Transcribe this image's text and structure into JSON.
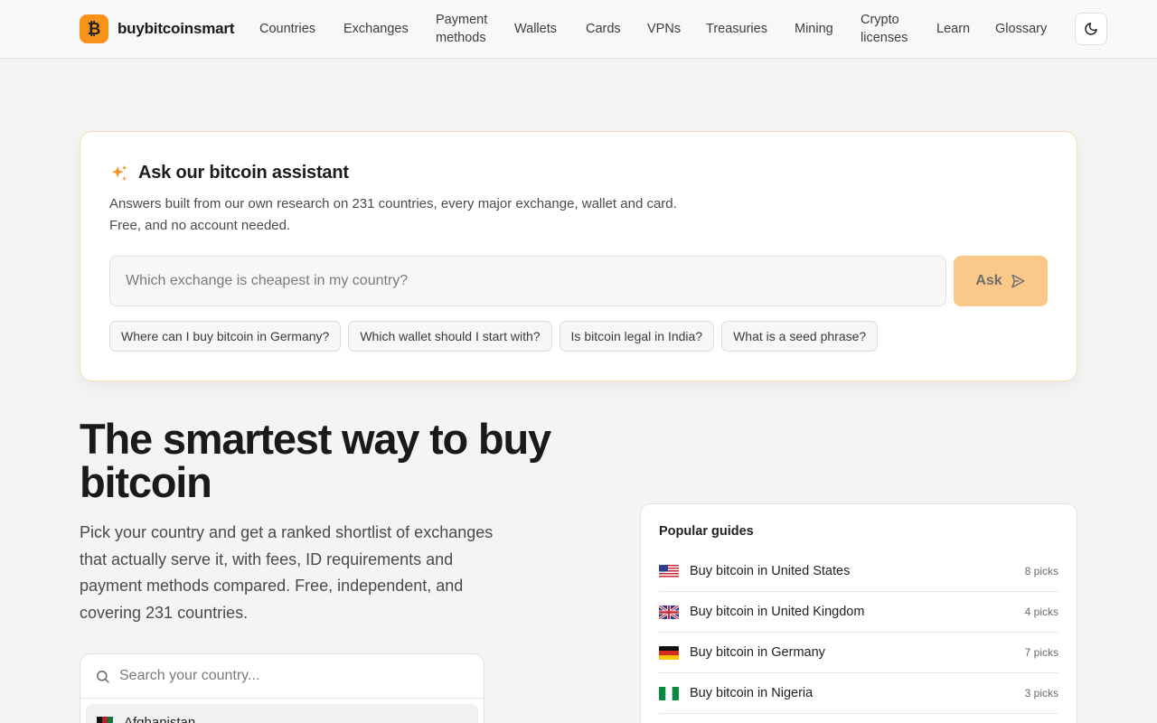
{
  "brand": {
    "logo_glyph": "₿",
    "name": "buybitcoinsmart",
    "accent": "#f7931a"
  },
  "nav": {
    "items": [
      {
        "label": "Countries"
      },
      {
        "label": "Exchanges"
      },
      {
        "label": "Payment methods"
      },
      {
        "label": "Wallets"
      },
      {
        "label": "Cards"
      },
      {
        "label": "VPNs"
      },
      {
        "label": "Treasuries"
      },
      {
        "label": "Mining"
      },
      {
        "label": "Crypto licenses"
      },
      {
        "label": "Learn"
      },
      {
        "label": "Glossary"
      }
    ],
    "theme_toggle_icon": "moon-icon"
  },
  "assistant": {
    "icon": "sparkles-icon",
    "title": "Ask our bitcoin assistant",
    "desc_line1": "Answers built from our own research on 231 countries, every major exchange, wallet and card.",
    "desc_line2": "Free, and no account needed.",
    "input_placeholder": "Which exchange is cheapest in my country?",
    "input_value": "",
    "ask_label": "Ask",
    "ask_icon": "send-icon",
    "suggestions": [
      "Where can I buy bitcoin in Germany?",
      "Which wallet should I start with?",
      "Is bitcoin legal in India?",
      "What is a seed phrase?"
    ]
  },
  "hero": {
    "title": "The smartest way to buy bitcoin",
    "subtitle": "Pick your country and get a ranked shortlist of exchanges that actually serve it, with fees, ID requirements and payment methods compared. Free, independent, and covering 231 countries."
  },
  "country_search": {
    "icon": "search-icon",
    "placeholder": "Search your country...",
    "value": "",
    "first_option": "Afghanistan"
  },
  "guides": {
    "title": "Popular guides",
    "items": [
      {
        "label": "Buy bitcoin in United States",
        "count": "8 picks",
        "flag": "us-flag-icon"
      },
      {
        "label": "Buy bitcoin in United Kingdom",
        "count": "4 picks",
        "flag": "uk-flag-icon"
      },
      {
        "label": "Buy bitcoin in Germany",
        "count": "7 picks",
        "flag": "de-flag-icon"
      },
      {
        "label": "Buy bitcoin in Nigeria",
        "count": "3 picks",
        "flag": "ng-flag-icon"
      }
    ]
  }
}
